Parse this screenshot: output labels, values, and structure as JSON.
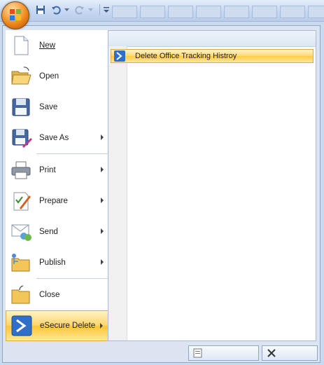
{
  "window": {
    "quick_access": [
      "save-icon",
      "undo-icon",
      "redo-icon",
      "customize-icon"
    ]
  },
  "office_menu": {
    "items": [
      {
        "label": "New",
        "icon": "new-document-icon",
        "has_submenu": false
      },
      {
        "label": "Open",
        "icon": "open-folder-icon",
        "has_submenu": false
      },
      {
        "label": "Save",
        "icon": "save-disk-icon",
        "has_submenu": false
      },
      {
        "label": "Save As",
        "icon": "save-as-icon",
        "has_submenu": true
      },
      {
        "label": "Print",
        "icon": "printer-icon",
        "has_submenu": true
      },
      {
        "label": "Prepare",
        "icon": "prepare-icon",
        "has_submenu": true
      },
      {
        "label": "Send",
        "icon": "send-icon",
        "has_submenu": true
      },
      {
        "label": "Publish",
        "icon": "publish-icon",
        "has_submenu": true
      },
      {
        "label": "Close",
        "icon": "close-folder-icon",
        "has_submenu": false
      },
      {
        "label": "eSecure Delete",
        "icon": "esecure-icon",
        "has_submenu": true,
        "active": true
      }
    ],
    "submenu": {
      "items": [
        {
          "label": "Delete Office Tracking Histroy",
          "icon": "esecure-small-icon"
        }
      ]
    },
    "footer_buttons": [
      {
        "icon": "options-icon"
      },
      {
        "icon": "exit-x-icon"
      }
    ]
  },
  "colors": {
    "highlight": "#ffd56b",
    "menu_frame": "#dbe4f0",
    "titlebar": "#c6d8f1"
  }
}
